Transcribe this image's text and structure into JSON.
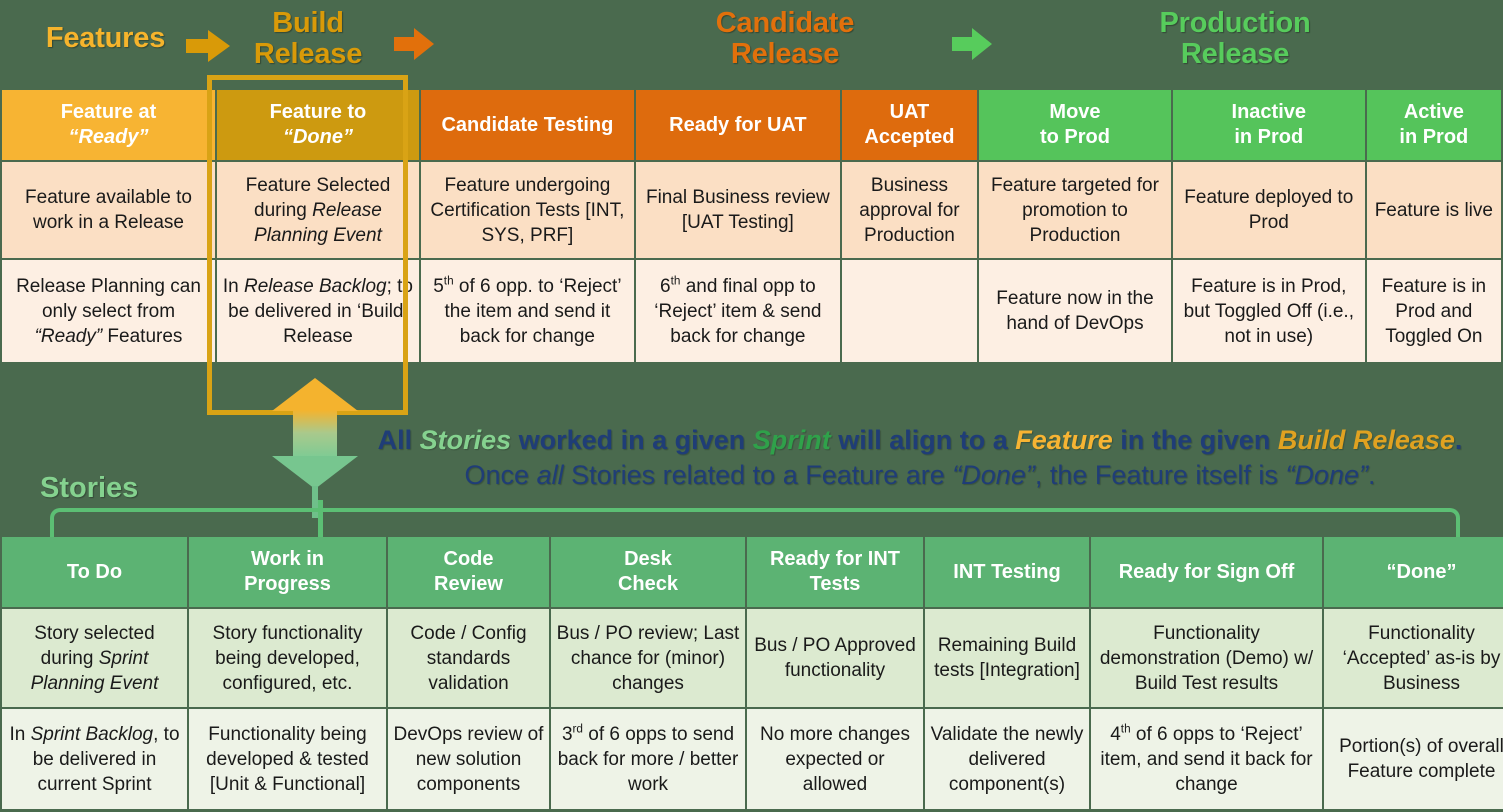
{
  "phases": {
    "features": "Features",
    "build_release": "Build\nRelease",
    "build_release_l1": "Build",
    "build_release_l2": "Release",
    "candidate_release_l1": "Candidate",
    "candidate_release_l2": "Release",
    "production_release_l1": "Production",
    "production_release_l2": "Release"
  },
  "colors": {
    "amber": "#f7b433",
    "gold": "#cd9a10",
    "orange": "#de6b0d",
    "green": "#55c45b",
    "story_green": "#5cb373",
    "navy": "#1f3d77",
    "background": "#4a6a4e"
  },
  "features_table": {
    "headers": [
      {
        "line1": "Feature at",
        "line2": "“Ready”",
        "color": "amber"
      },
      {
        "line1": "Feature to",
        "line2": "“Done”",
        "color": "gold"
      },
      {
        "line1": "Candidate Testing",
        "line2": "",
        "color": "orange"
      },
      {
        "line1": "Ready for UAT",
        "line2": "",
        "color": "orange"
      },
      {
        "line1": "UAT",
        "line2": "Accepted",
        "color": "orange"
      },
      {
        "line1": "Move",
        "line2": "to Prod",
        "color": "green"
      },
      {
        "line1": "Inactive",
        "line2": "in Prod",
        "color": "green"
      },
      {
        "line1": "Active",
        "line2": "in Prod",
        "color": "green"
      }
    ],
    "row1": [
      "Feature available to work in a Release",
      "Feature Selected during Release Planning Event",
      "Feature undergoing Certification Tests [INT, SYS, PRF]",
      "Final Business review [UAT Testing]",
      "Business approval for Production",
      "Feature targeted for promotion to Production",
      "Feature deployed to Prod",
      "Feature is live"
    ],
    "row2": [
      "Release Planning can only select from “Ready” Features",
      "In Release Backlog; to be delivered in ‘Build’ Release",
      "5th of 6 opp. to ‘Reject’ the item and send it back for change",
      "6th and final opp to ‘Reject’ item & send back for change",
      "",
      "Feature now in the hand of DevOps",
      "Feature is in Prod, but Toggled Off (i.e., not in use)",
      "Feature is in Prod and Toggled On"
    ]
  },
  "center_note": {
    "line1_full": "All Stories worked in a given Sprint will align to a Feature in the given Build Release.",
    "line2_full": "Once all Stories related to a Feature are “Done”, the Feature itself is “Done”.",
    "l1_a": "All ",
    "l1_stories": "Stories",
    "l1_b": " worked in a given ",
    "l1_sprint": "Sprint",
    "l1_c": " will align to a ",
    "l1_feature": "Feature",
    "l1_d": " in the given ",
    "l1_build": "Build Release",
    "l1_e": ".",
    "l2_a": "Once ",
    "l2_all": "all",
    "l2_b": " Stories related to a Feature are ",
    "l2_done1": "“Done”",
    "l2_c": ", the Feature itself is ",
    "l2_done2": "“Done”",
    "l2_d": "."
  },
  "stories_label": "Stories",
  "stories_table": {
    "headers": [
      {
        "line1": "To Do",
        "line2": ""
      },
      {
        "line1": "Work in",
        "line2": "Progress"
      },
      {
        "line1": "Code",
        "line2": "Review"
      },
      {
        "line1": "Desk",
        "line2": "Check"
      },
      {
        "line1": "Ready for INT",
        "line2": "Tests"
      },
      {
        "line1": "INT Testing",
        "line2": ""
      },
      {
        "line1": "Ready for Sign Off",
        "line2": ""
      },
      {
        "line1": "“Done”",
        "line2": ""
      }
    ],
    "row1": [
      "Story selected during Sprint Planning Event",
      "Story functionality being developed, configured, etc.",
      "Code / Config standards validation",
      "Bus / PO review; Last chance for (minor) changes",
      "Bus / PO Approved functionality",
      "Remaining Build tests [Integration]",
      "Functionality demonstration (Demo) w/ Build Test results",
      "Functionality ‘Accepted’ as-is by Business"
    ],
    "row2": [
      "In Sprint Backlog, to be delivered in current Sprint",
      "Functionality being developed & tested [Unit & Functional]",
      "DevOps review of new solution components",
      "3rd of 6 opps to send back for more / better work",
      "No more changes expected or allowed",
      "Validate the newly delivered component(s)",
      "4th of 6 opps to ‘Reject’ item, and send it back for change",
      "Portion(s) of overall Feature complete"
    ]
  }
}
